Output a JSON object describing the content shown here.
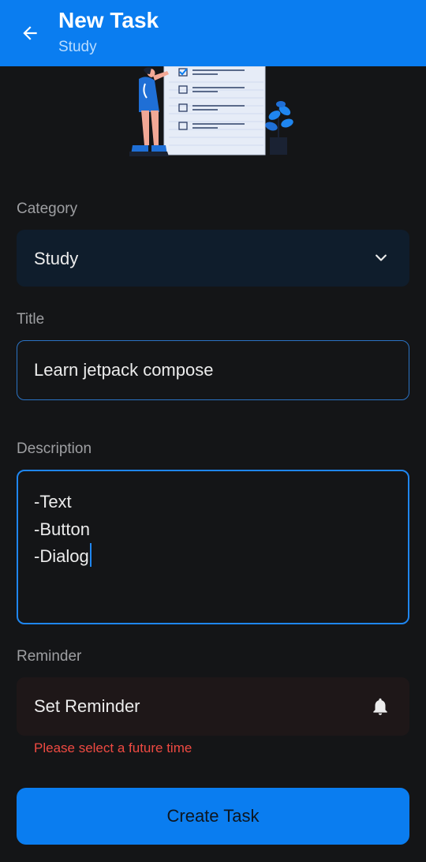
{
  "app_bar": {
    "title": "New Task",
    "subtitle": "Study",
    "back_icon": "arrow-back-icon"
  },
  "category": {
    "label": "Category",
    "selected": "Study",
    "icon": "chevron-down-icon"
  },
  "title_field": {
    "label": "Title",
    "value": "Learn jetpack compose"
  },
  "description_field": {
    "label": "Description",
    "lines": [
      "-Text",
      "-Button",
      "-Dialog"
    ]
  },
  "reminder": {
    "label": "Reminder",
    "placeholder": "Set Reminder",
    "icon": "bell-icon",
    "error": "Please select a future time"
  },
  "actions": {
    "create_label": "Create Task"
  },
  "colors": {
    "accent": "#0a7df0",
    "background": "#141517",
    "error": "#ef4a42"
  }
}
